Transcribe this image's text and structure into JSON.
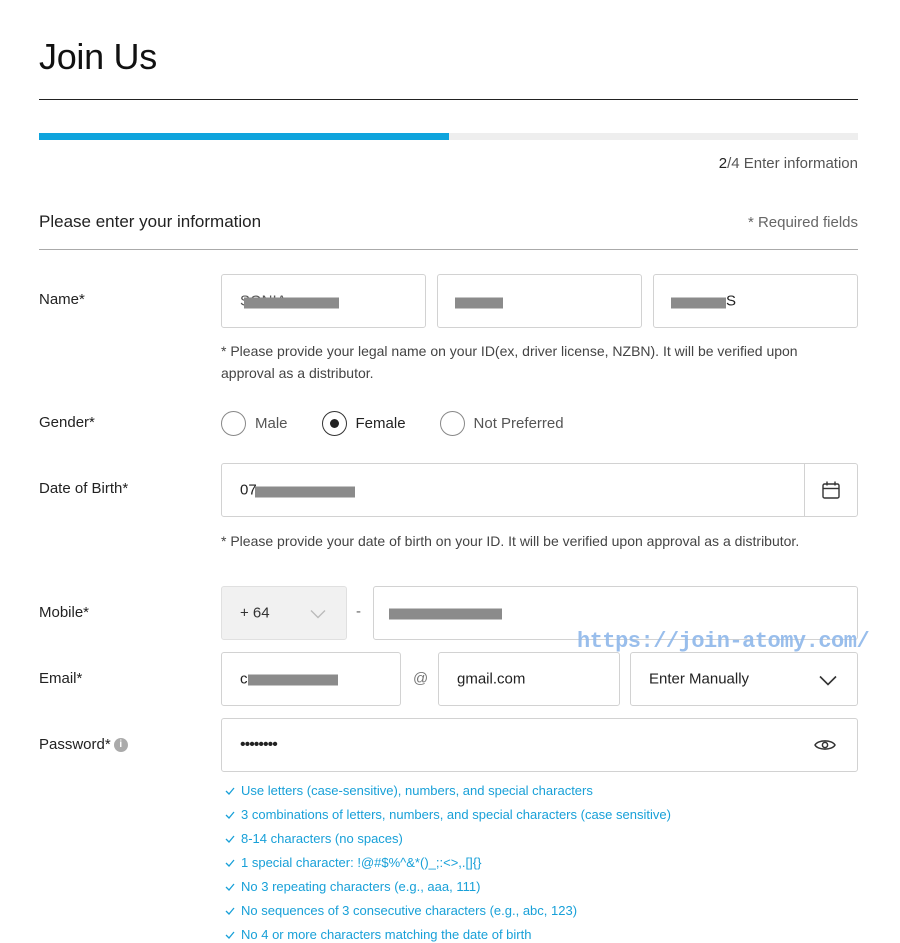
{
  "page": {
    "title": "Join Us"
  },
  "progress": {
    "fraction": 0.5,
    "step_number": "2",
    "step_total_text": "/4 Enter information"
  },
  "section": {
    "title": "Please enter your information",
    "required_note": "* Required fields"
  },
  "name": {
    "label": "Name*",
    "first_value": "SONIA",
    "last_value_suffix": "S",
    "hint": "* Please provide your legal name on your ID(ex, driver license, NZBN). It will be verified upon approval as a distributor."
  },
  "gender": {
    "label": "Gender*",
    "options": [
      "Male",
      "Female",
      "Not Preferred"
    ],
    "selected": "Female"
  },
  "dob": {
    "label": "Date of Birth*",
    "value_prefix": "07",
    "hint": "* Please provide your date of birth on your ID. It will be verified upon approval as a distributor."
  },
  "mobile": {
    "label": "Mobile*",
    "country_code": "+ 64",
    "separator": "-"
  },
  "email": {
    "label": "Email*",
    "local_prefix": "c",
    "at_symbol": "@",
    "domain_value": "gmail.com",
    "domain_select": "Enter Manually"
  },
  "password": {
    "label": "Password*",
    "info": "i",
    "value": "••••••••",
    "rules": [
      "Use letters (case-sensitive), numbers, and special characters",
      "3 combinations of letters, numbers, and special characters (case sensitive)",
      "8-14 characters (no spaces)",
      "1 special character: !@#$%^&*()_;:<>,.[]{}",
      "No 3 repeating characters (e.g., aaa, 111)",
      "No sequences of 3 consecutive characters (e.g., abc, 123)",
      "No 4 or more characters matching the date of birth"
    ]
  },
  "watermark": "https://join-atomy.com/",
  "colors": {
    "accent": "#0ea4dd",
    "rule_text": "#18a0d8"
  },
  "icons": {
    "calendar": "calendar-icon",
    "eye": "eye-icon",
    "dropdown": "chevron-down-icon",
    "check": "check-icon"
  }
}
